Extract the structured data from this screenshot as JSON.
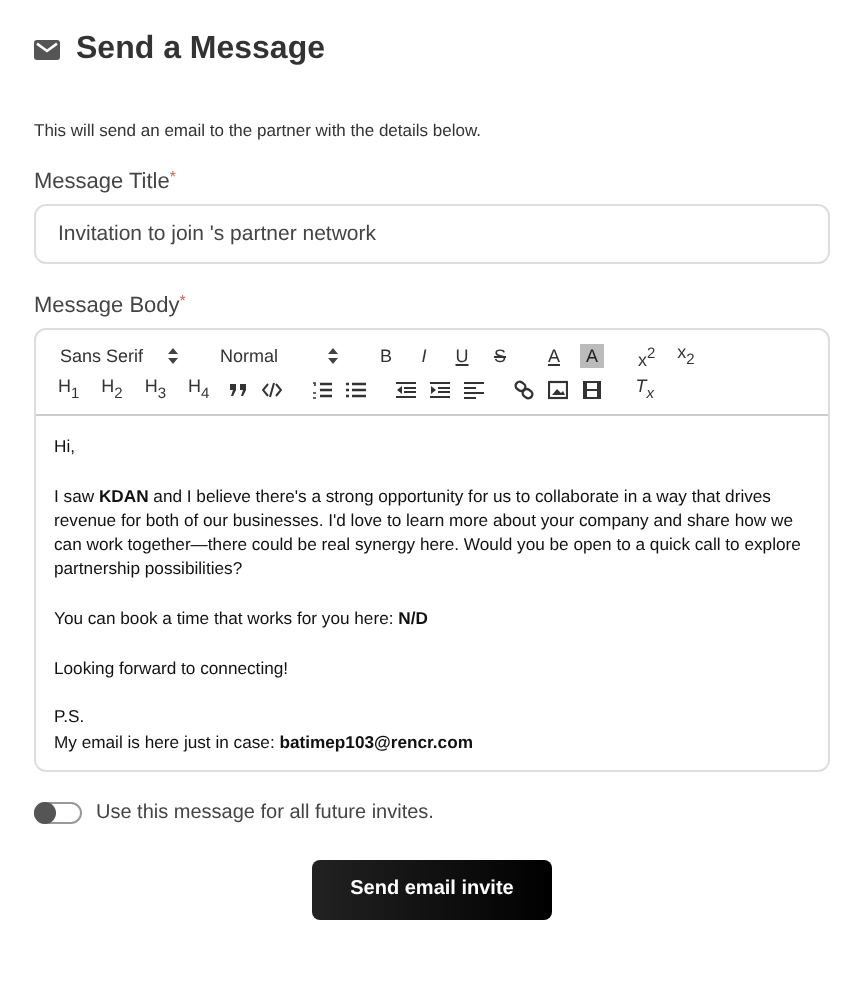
{
  "header": {
    "title": "Send a Message"
  },
  "description": "This will send an email to the partner with the details below.",
  "title_field": {
    "label": "Message Title",
    "required_mark": "*",
    "value": "Invitation to join 's partner network"
  },
  "body_field": {
    "label": "Message Body",
    "required_mark": "*"
  },
  "toolbar": {
    "top_items": [
      {
        "kind": "select",
        "label": "Sans Serif"
      },
      {
        "kind": "select",
        "label": "Normal"
      },
      {
        "kind": "bold",
        "label": "B"
      },
      {
        "kind": "italic",
        "label": "I"
      },
      {
        "kind": "underline",
        "label": "U"
      },
      {
        "kind": "strike",
        "label": "S"
      },
      {
        "kind": "color",
        "label": "A"
      },
      {
        "kind": "highlight",
        "label": "A"
      },
      {
        "kind": "text",
        "label": "x$^{2}$"
      },
      {
        "kind": "text",
        "label": "x$_{2}$"
      }
    ],
    "bottom_items": [
      {
        "kind": "text",
        "label": "H$_{1}$"
      },
      {
        "kind": "text",
        "label": "H$_{2}$"
      },
      {
        "kind": "text",
        "label": "H$_{3}$"
      },
      {
        "kind": "text",
        "label": "H$_{4}$"
      },
      {
        "kind": "quote"
      },
      {
        "kind": "code"
      },
      {
        "kind": "ordered"
      },
      {
        "kind": "bullet"
      },
      {
        "kind": "outdent"
      },
      {
        "kind": "indent"
      },
      {
        "kind": "align"
      },
      {
        "kind": "link"
      },
      {
        "kind": "image"
      },
      {
        "kind": "video"
      },
      {
        "kind": "clean",
        "label": "T$_{x}$"
      }
    ]
  },
  "body": [
    {
      "lines": [
        "Hi,"
      ]
    },
    {
      "lines": [
        "I saw **KDAN** and I believe there's a strong opportunity for us to collaborate in a way that drives revenue for both of our businesses. I'd love to learn more about your company and share how we can work together—there could be real synergy here. Would you be open to a quick call to explore partnership possibilities?"
      ]
    },
    {
      "lines": [
        "You can book a time that works for you here: **N/D**"
      ]
    },
    {
      "lines": [
        "Looking forward to connecting!"
      ]
    },
    {
      "lines": [
        "P.S.",
        "My email is here just in case: **batimep103@rencr.com**"
      ]
    }
  ],
  "toggle": {
    "label": "Use this message for all future invites.",
    "on": false
  },
  "submit": {
    "label": "Send email invite"
  }
}
